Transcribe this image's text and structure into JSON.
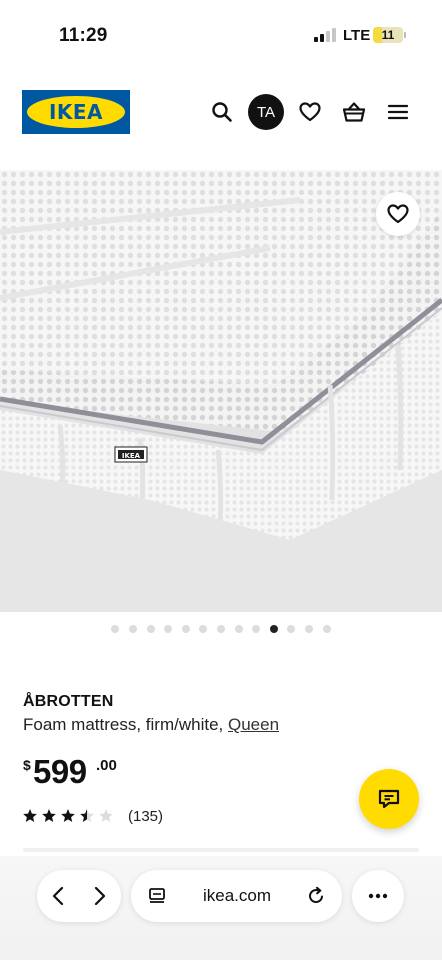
{
  "status_bar": {
    "time": "11:29",
    "network": "LTE",
    "battery": "11",
    "battery_level_percent": 11
  },
  "header": {
    "logo_text": "IKEA",
    "avatar_initials": "TA",
    "icons": [
      "search-icon",
      "heart-icon",
      "basket-icon",
      "menu-icon"
    ]
  },
  "carousel": {
    "total_images": 13,
    "active_index": 9
  },
  "product": {
    "name": "ÅBROTTEN",
    "description": "Foam mattress, firm/white, ",
    "size_link": "Queen",
    "price_currency": "$",
    "price_integer": "599",
    "price_decimal": ".00",
    "rating_value": 3.5,
    "rating_max": 5,
    "review_count": "(135)"
  },
  "browser": {
    "url": "ikea.com"
  },
  "colors": {
    "brand_blue": "#0058a3",
    "brand_yellow": "#ffdb00",
    "text": "#111111"
  }
}
